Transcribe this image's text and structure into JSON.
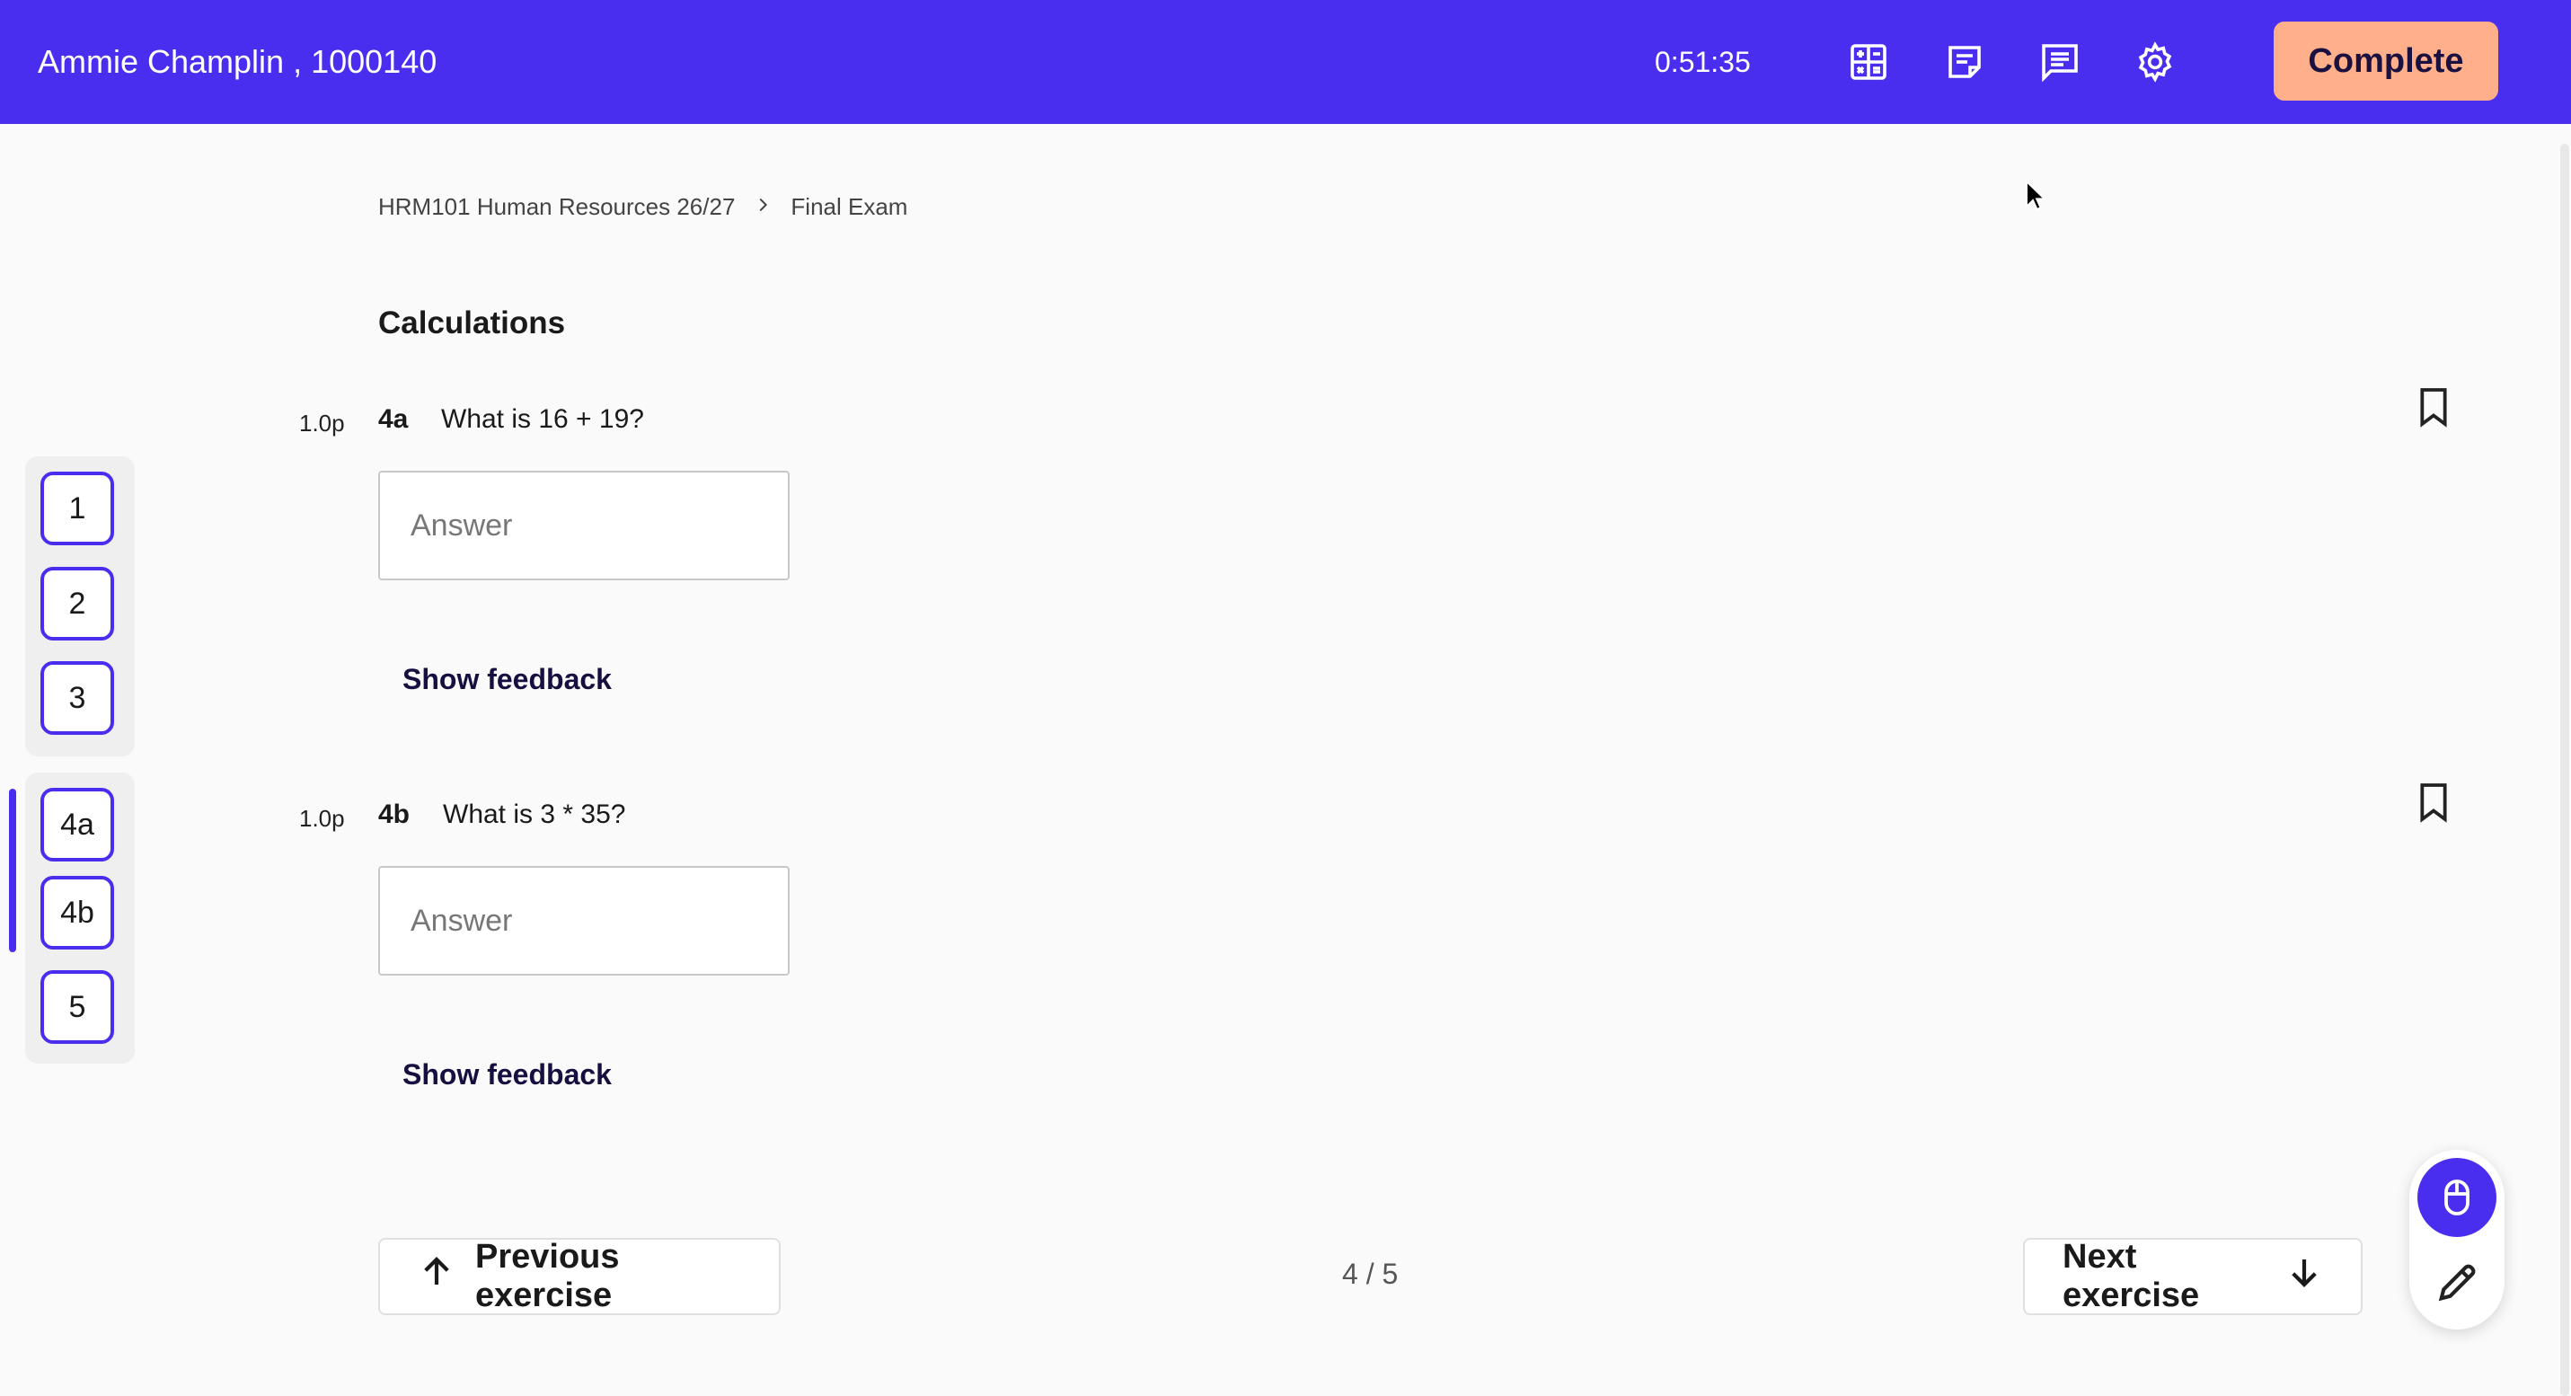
{
  "header": {
    "student": "Ammie Champlin , 1000140",
    "timer": "0:51:35",
    "icons": [
      "calculator-icon",
      "notes-icon",
      "chat-icon",
      "settings-icon"
    ],
    "complete_label": "Complete"
  },
  "breadcrumb": {
    "course": "HRM101 Human Resources 26/27",
    "exam": "Final Exam"
  },
  "section_title": "Calculations",
  "sidebar": {
    "group1": [
      "1",
      "2",
      "3"
    ],
    "group2": [
      "4a",
      "4b",
      "5"
    ],
    "active": "4a-4b"
  },
  "questions": [
    {
      "points": "1.0p",
      "number": "4a",
      "text": "What is 16 + 19?",
      "placeholder": "Answer",
      "value": "",
      "feedback_label": "Show feedback"
    },
    {
      "points": "1.0p",
      "number": "4b",
      "text": "What is 3 * 35?",
      "placeholder": "Answer",
      "value": "",
      "feedback_label": "Show feedback"
    }
  ],
  "footer": {
    "previous_label": "Previous exercise",
    "next_label": "Next exercise",
    "page": "4 / 5"
  },
  "colors": {
    "brand": "#4a2ef0",
    "complete": "#ffb08a"
  }
}
